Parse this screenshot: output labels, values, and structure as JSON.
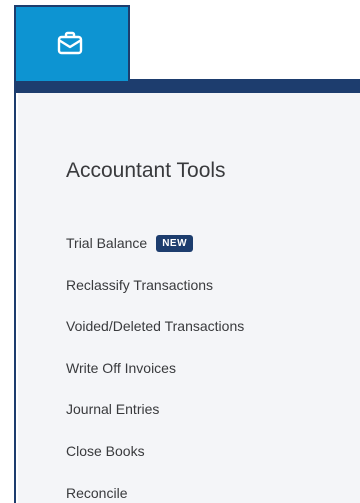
{
  "toolbar": {
    "button_icon": "briefcase-icon",
    "accent_color": "#0d94d2",
    "border_color": "#1d3d6e"
  },
  "panel": {
    "title": "Accountant Tools",
    "items": [
      {
        "label": "Trial Balance",
        "badge": "NEW"
      },
      {
        "label": "Reclassify Transactions"
      },
      {
        "label": "Voided/Deleted Transactions"
      },
      {
        "label": "Write Off Invoices"
      },
      {
        "label": "Journal Entries"
      },
      {
        "label": "Close Books"
      },
      {
        "label": "Reconcile"
      }
    ]
  }
}
